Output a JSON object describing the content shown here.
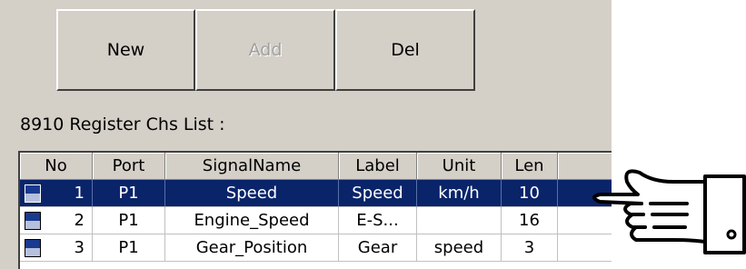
{
  "buttons": {
    "new": "New",
    "add": "Add",
    "del": "Del"
  },
  "list_label": "8910 Register Chs List :",
  "columns": [
    "No",
    "Port",
    "SignalName",
    "Label",
    "Unit",
    "Len",
    ""
  ],
  "rows": [
    {
      "no": "1",
      "port": "P1",
      "signal": "Speed",
      "label": "Speed",
      "unit": "km/h",
      "len": "10",
      "selected": true
    },
    {
      "no": "2",
      "port": "P1",
      "signal": "Engine_Speed",
      "label": "E-S...",
      "unit": "",
      "len": "16",
      "selected": false
    },
    {
      "no": "3",
      "port": "P1",
      "signal": "Gear_Position",
      "label": "Gear",
      "unit": "speed",
      "len": "3",
      "selected": false
    }
  ],
  "row_icon": "cam-reg-icon",
  "pointer_icon": "pointing-hand-icon",
  "colors": {
    "panel": "#d4d0c8",
    "selection": "#0a246a"
  }
}
